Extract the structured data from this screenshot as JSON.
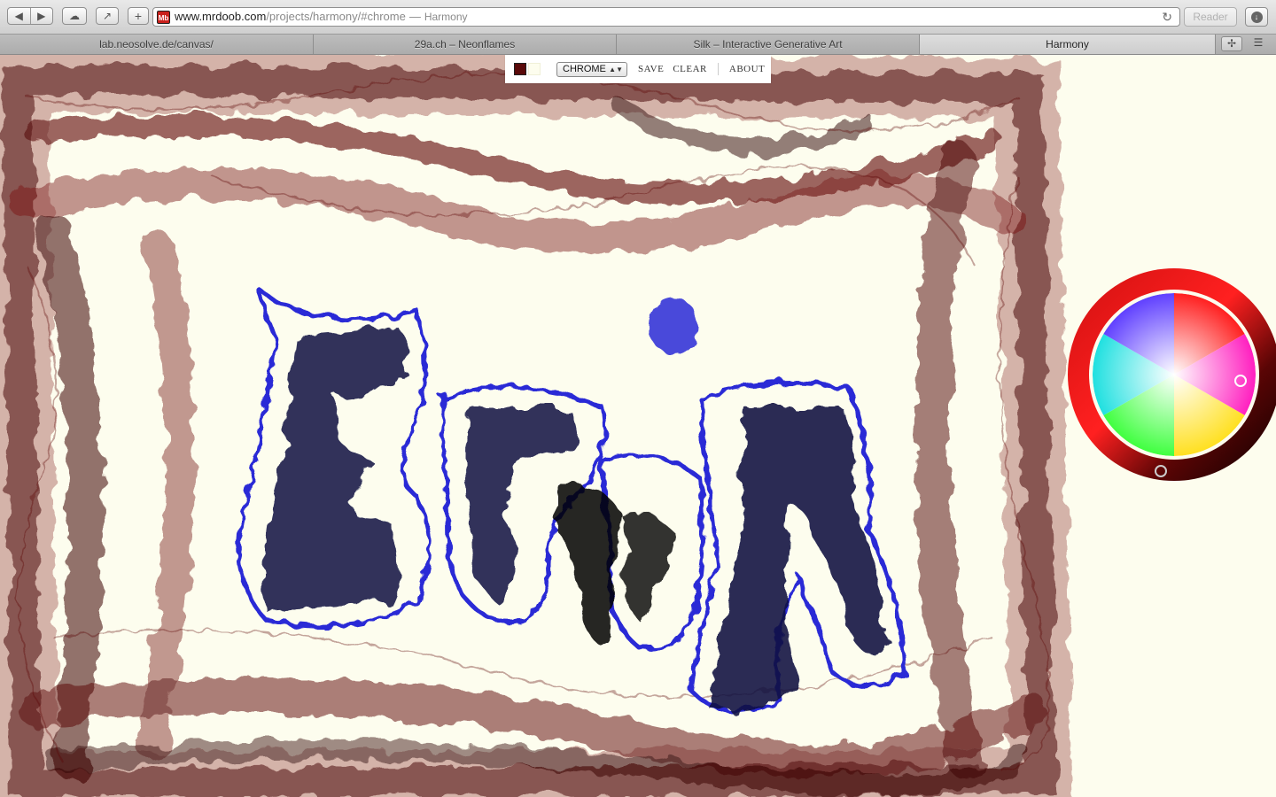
{
  "browser": {
    "url_domain": "www.mrdoob.com",
    "url_path": "/projects/harmony/#chrome",
    "url_separator": "—",
    "page_title": "Harmony",
    "reader_label": "Reader",
    "favicon_text": "Mb",
    "tabs": [
      {
        "label": "lab.neosolve.de/canvas/"
      },
      {
        "label": "29a.ch – Neonflames"
      },
      {
        "label": "Silk – Interactive Generative Art"
      },
      {
        "label": "Harmony",
        "active": true
      }
    ]
  },
  "toolbar": {
    "brush": "CHROME",
    "save_label": "SAVE",
    "clear_label": "CLEAR",
    "about_label": "ABOUT",
    "foreground_color": "#5a0a0a",
    "background_color": "#fdfdee"
  },
  "icons": [
    "back-icon",
    "forward-icon",
    "icloud-icon",
    "share-icon",
    "add-icon",
    "reload-icon",
    "download-icon",
    "new-tab-icon",
    "tab-list-icon"
  ],
  "colors": {
    "page_background": "#fdfdee",
    "stroke_dark_red": "#4a0505",
    "stroke_blue": "#2b2bd6",
    "stroke_navy": "#0a0f40"
  }
}
